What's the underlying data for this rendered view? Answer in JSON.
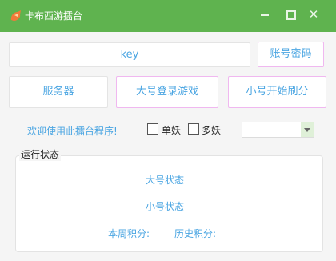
{
  "window": {
    "title": "卡布西游擂台",
    "minimize_icon": "minimize-icon",
    "maximize_icon": "maximize-icon",
    "close_glyph": "✕",
    "title_color": "#5fb34f",
    "accent_color": "#4aa5e2"
  },
  "key_field": {
    "value": "key"
  },
  "buttons": {
    "account_password": "账号密码",
    "server": "服务器",
    "big_login": "大号登录游戏",
    "small_start": "小号开始刷分"
  },
  "welcome_text": "欢迎使用此擂台程序!",
  "options": {
    "single": "单妖",
    "multi": "多妖"
  },
  "select": {
    "value": ""
  },
  "status_group": {
    "legend": "运行状态",
    "big_status": "大号状态",
    "small_status": "小号状态",
    "week_points_label": "本周积分:",
    "history_points_label": "历史积分:"
  }
}
